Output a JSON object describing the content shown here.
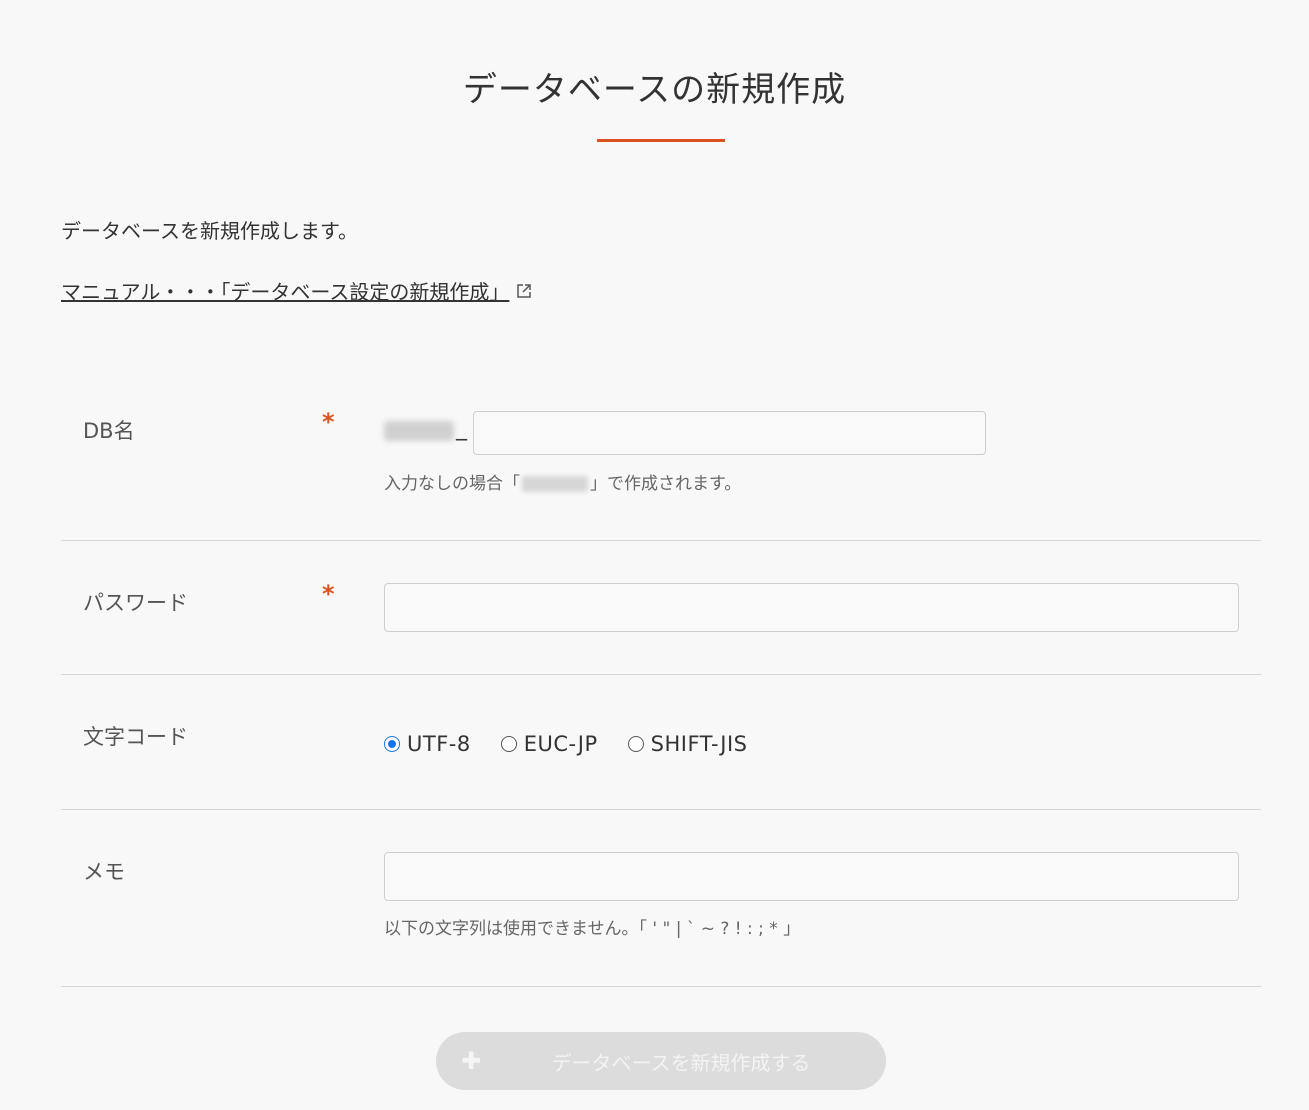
{
  "modal": {
    "title": "データベースの新規作成",
    "intro": "データベースを新規作成します。",
    "manual_link": "マニュアル・・・「データベース設定の新規作成」"
  },
  "fields": {
    "db_name": {
      "label": "DB名",
      "required_mark": "*",
      "separator": "_",
      "value": "",
      "hint_before": "入力なしの場合「",
      "hint_after": "」で作成されます。"
    },
    "password": {
      "label": "パスワード",
      "required_mark": "*",
      "value": ""
    },
    "charset": {
      "label": "文字コード",
      "options": [
        "UTF-8",
        "EUC-JP",
        "SHIFT-JIS"
      ],
      "selected": "UTF-8"
    },
    "memo": {
      "label": "メモ",
      "value": "",
      "hint": "以下の文字列は使用できません。「 ' \" | ` ~ ? ! : ; * 」"
    }
  },
  "submit": {
    "icon": "plus-icon",
    "label": "データベースを新規作成する",
    "enabled": false
  },
  "colors": {
    "accent": "#d9541e",
    "radio_checked": "#1a73e8",
    "button_disabled": "#dcdcdc"
  }
}
